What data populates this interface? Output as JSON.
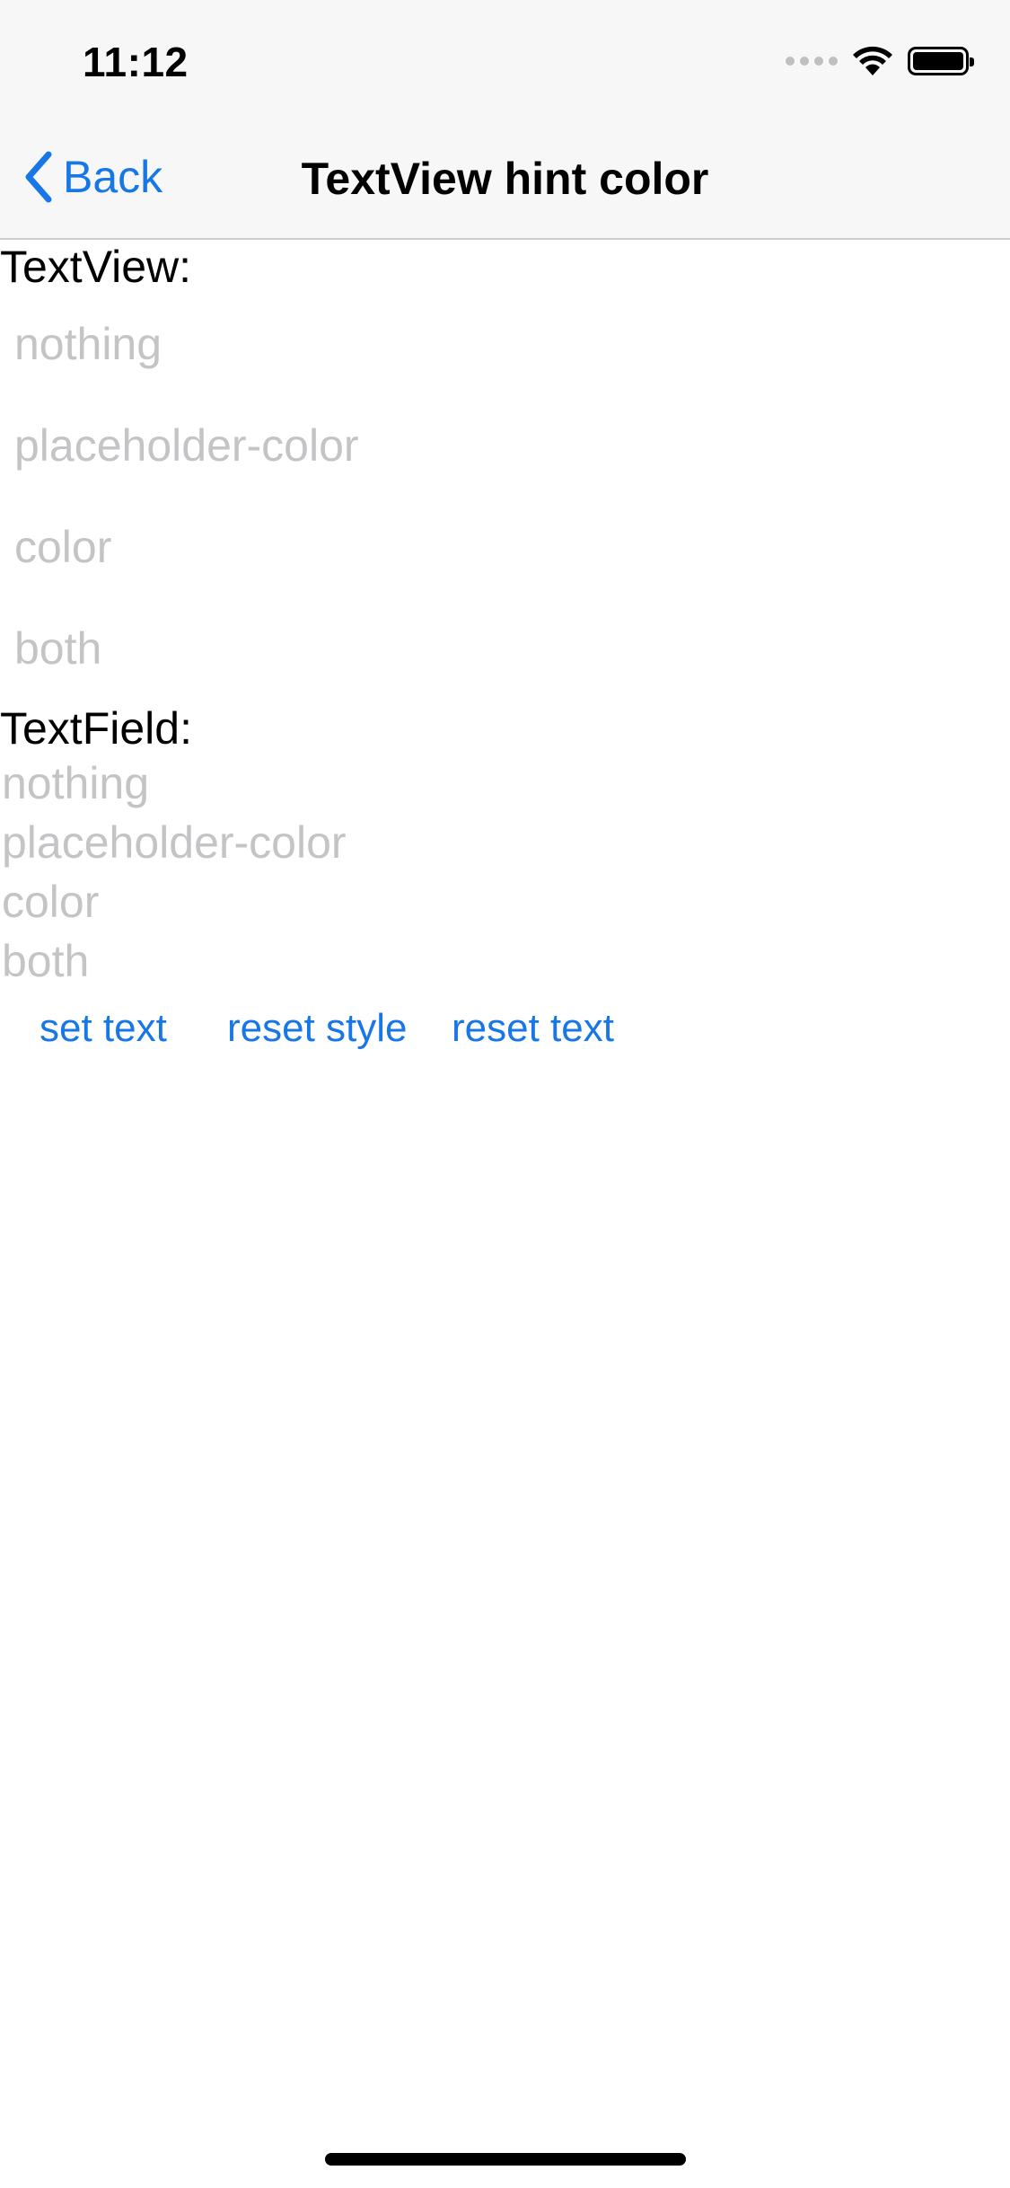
{
  "status_bar": {
    "time": "11:12"
  },
  "nav": {
    "back_label": "Back",
    "title": "TextView hint color"
  },
  "textview_section": {
    "label": "TextView:",
    "fields": [
      "nothing",
      "placeholder-color",
      "color",
      "both"
    ]
  },
  "textfield_section": {
    "label": "TextField:",
    "fields": [
      "nothing",
      "placeholder-color",
      "color",
      "both"
    ]
  },
  "actions": {
    "set_text": "set text",
    "reset_style": "reset style",
    "reset_text": "reset text"
  },
  "colors": {
    "accent": "#1877e6",
    "placeholder": "#c4c4c6",
    "nav_background": "#f7f7f7"
  },
  "icons": {
    "back": "chevron-left-icon",
    "wifi": "wifi-icon",
    "battery": "battery-icon",
    "signal": "cellular-signal-icon"
  }
}
